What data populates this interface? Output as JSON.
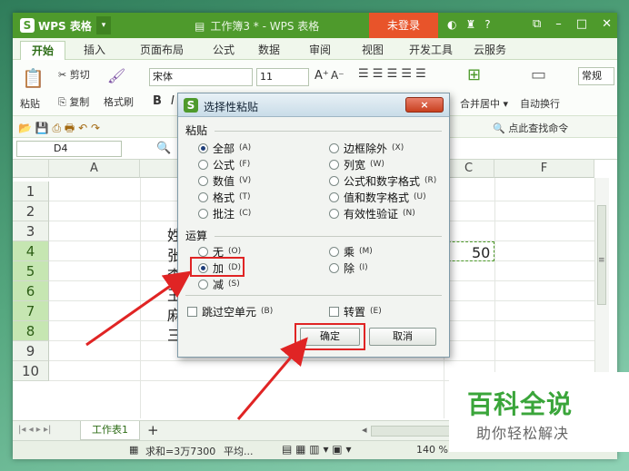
{
  "app": {
    "name": "WPS 表格",
    "doc_title": "工作簿3 * - WPS 表格",
    "login": "未登录",
    "help": "?"
  },
  "tabs": [
    "开始",
    "插入",
    "页面布局",
    "公式",
    "数据",
    "审阅",
    "视图",
    "开发工具",
    "云服务"
  ],
  "ribbon": {
    "paste": "粘贴",
    "cut": "剪切",
    "copy": "复制",
    "format_painter": "格式刷",
    "font": "宋体",
    "font_size": "11",
    "bold": "B",
    "italic": "I",
    "merge_center": "合并居中",
    "wrap": "自动换行",
    "number_format": "常规",
    "find": "点此查找命令"
  },
  "formula": {
    "name_box": "D4"
  },
  "grid": {
    "columns": [
      "A",
      "C",
      "F"
    ],
    "rows": [
      "1",
      "2",
      "3",
      "4",
      "5",
      "6",
      "7",
      "8",
      "9",
      "10"
    ],
    "peek": [
      "姓",
      "张",
      "李",
      "王",
      "麻",
      "三"
    ],
    "value_c4": "50"
  },
  "sheet": {
    "tab": "工作表1",
    "add": "+"
  },
  "status": {
    "sum": "求和=3万7300",
    "avg": "平均...",
    "zoom": "140 %"
  },
  "dialog": {
    "title": "选择性粘贴",
    "close": "×",
    "paste_label": "粘贴",
    "paste_left": [
      {
        "label": "全部",
        "key": "(A)"
      },
      {
        "label": "公式",
        "key": "(F)"
      },
      {
        "label": "数值",
        "key": "(V)"
      },
      {
        "label": "格式",
        "key": "(T)"
      },
      {
        "label": "批注",
        "key": "(C)"
      }
    ],
    "paste_right": [
      {
        "label": "边框除外",
        "key": "(X)"
      },
      {
        "label": "列宽",
        "key": "(W)"
      },
      {
        "label": "公式和数字格式",
        "key": "(R)"
      },
      {
        "label": "值和数字格式",
        "key": "(U)"
      },
      {
        "label": "有效性验证",
        "key": "(N)"
      }
    ],
    "op_label": "运算",
    "op_left": [
      {
        "label": "无",
        "key": "(O)"
      },
      {
        "label": "加",
        "key": "(D)"
      },
      {
        "label": "减",
        "key": "(S)"
      }
    ],
    "op_right": [
      {
        "label": "乘",
        "key": "(M)"
      },
      {
        "label": "除",
        "key": "(I)"
      }
    ],
    "skip_blanks": {
      "label": "跳过空单元",
      "key": "(B)"
    },
    "transpose": {
      "label": "转置",
      "key": "(E)"
    },
    "ok": "确定",
    "cancel": "取消"
  },
  "watermark": {
    "title": "百科全说",
    "subtitle": "助你轻松解决"
  },
  "colors": {
    "accent": "#4e9a2c",
    "login": "#e8542a",
    "highlight": "#e02424"
  }
}
